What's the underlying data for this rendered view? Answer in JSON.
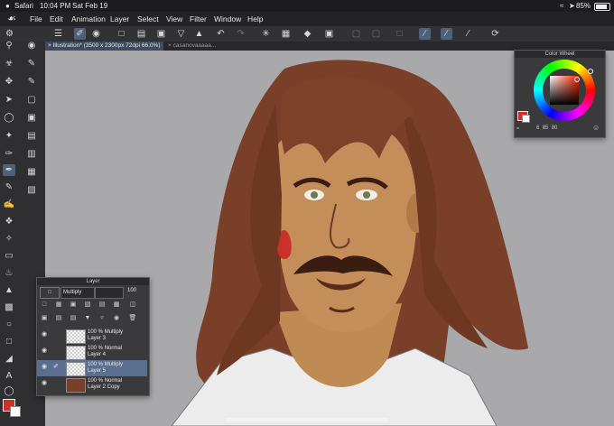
{
  "status_bar": {
    "carrier": "Safari",
    "time": "10:04 PM",
    "date": "Sat Feb 19",
    "battery": "85%"
  },
  "menu": {
    "items": [
      "File",
      "Edit",
      "Animation",
      "Layer",
      "Select",
      "View",
      "Filter",
      "Window",
      "Help"
    ]
  },
  "tabs": [
    {
      "label": "Illustration* (3500 x 2300px 72dpi 66.0%)",
      "active": true
    },
    {
      "label": "casanovaaaaa...",
      "active": false
    }
  ],
  "color_wheel": {
    "title": "Color Wheel",
    "h": "6",
    "s": "85",
    "v": "80",
    "main_color": "#c8322a",
    "sub_color": "#ffffff"
  },
  "layer_panel": {
    "title": "Layer",
    "blend_mode": "Multiply",
    "opacity": "100",
    "layers": [
      {
        "pct": "100 %",
        "blend": "Multiply",
        "name": "Layer 3",
        "selected": false
      },
      {
        "pct": "100 %",
        "blend": "Normal",
        "name": "Layer 4",
        "selected": false
      },
      {
        "pct": "100 %",
        "blend": "Multiply",
        "name": "Layer 5",
        "selected": true
      },
      {
        "pct": "100 %",
        "blend": "Normal",
        "name": "Layer 2 Copy",
        "selected": false
      }
    ]
  },
  "colors": {
    "skin": "#c08a55",
    "hair": "#7a3f28",
    "hair_dark": "#5a2b1a",
    "shirt": "#ececec",
    "canvas_bg": "#a9a9ab"
  }
}
